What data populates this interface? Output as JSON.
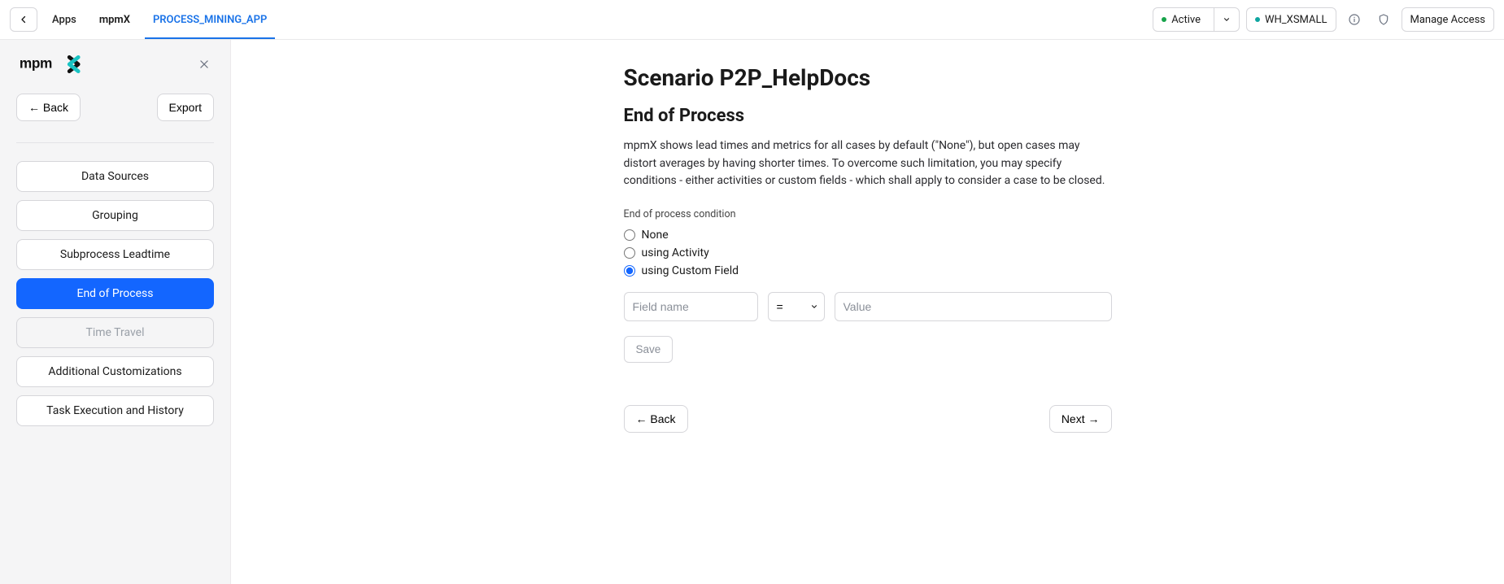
{
  "header": {
    "breadcrumbs": [
      "Apps",
      "mpmX",
      "PROCESS_MINING_APP"
    ],
    "active_index": 2,
    "status": {
      "label": "Active"
    },
    "warehouse": {
      "label": "WH_XSMALL"
    },
    "manage_access": "Manage Access"
  },
  "sidebar": {
    "logo_text": "mpmX",
    "back": "← Back",
    "export": "Export",
    "items": [
      {
        "label": "Data Sources",
        "state": "default"
      },
      {
        "label": "Grouping",
        "state": "default"
      },
      {
        "label": "Subprocess Leadtime",
        "state": "default"
      },
      {
        "label": "End of Process",
        "state": "active"
      },
      {
        "label": "Time Travel",
        "state": "disabled"
      },
      {
        "label": "Additional Customizations",
        "state": "default"
      },
      {
        "label": "Task Execution and History",
        "state": "default"
      }
    ]
  },
  "content": {
    "title": "Scenario P2P_HelpDocs",
    "subtitle": "End of Process",
    "description": "mpmX shows lead times and metrics for all cases by default (\"None\"), but open cases may distort averages by having shorter times. To overcome such limitation, you may specify conditions - either activities or custom fields - which shall apply to consider a case to be closed.",
    "condition_label": "End of process condition",
    "radios": [
      {
        "label": "None",
        "checked": false
      },
      {
        "label": "using Activity",
        "checked": false
      },
      {
        "label": "using Custom Field",
        "checked": true
      }
    ],
    "fields": {
      "fieldname_placeholder": "Field name",
      "operator": "=",
      "value_placeholder": "Value"
    },
    "save": "Save",
    "pager": {
      "back": "← Back",
      "next": "Next →"
    }
  }
}
